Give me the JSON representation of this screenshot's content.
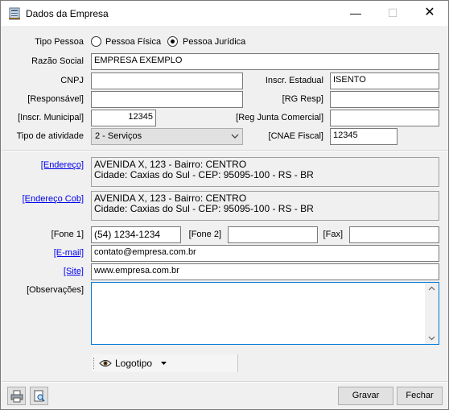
{
  "window": {
    "title": "Dados da Empresa",
    "minimize": "—",
    "maximize": "☐",
    "close": "✕"
  },
  "tipo_pessoa": {
    "label": "Tipo Pessoa",
    "option_fisica": "Pessoa Física",
    "option_juridica": "Pessoa Jurídica",
    "selected": "Pessoa Jurídica"
  },
  "razao_social": {
    "label": "Razão Social",
    "value": "EMPRESA EXEMPLO"
  },
  "cnpj": {
    "label": "CNPJ",
    "value": ""
  },
  "inscr_estadual": {
    "label": "Inscr. Estadual",
    "value": "ISENTO"
  },
  "responsavel": {
    "label": "[Responsável]",
    "value": ""
  },
  "rg_resp": {
    "label": "[RG Resp]",
    "value": ""
  },
  "inscr_municipal": {
    "label": "[Inscr. Municipal]",
    "value": "12345"
  },
  "reg_junta": {
    "label": "[Reg Junta Comercial]",
    "value": ""
  },
  "tipo_atividade": {
    "label": "Tipo de atividade",
    "value": "2 - Serviços"
  },
  "cnae_fiscal": {
    "label": "[CNAE Fiscal]",
    "value": "12345"
  },
  "endereco": {
    "label": "[Endereço]",
    "line1": "AVENIDA X, 123  -  Bairro: CENTRO",
    "line2": "Cidade: Caxias do Sul  -  CEP: 95095-100  -  RS  -  BR"
  },
  "endereco_cob": {
    "label": "[Endereço Cob]",
    "line1": "AVENIDA X, 123  -  Bairro: CENTRO",
    "line2": "Cidade: Caxias do Sul  -  CEP: 95095-100  -  RS  -  BR"
  },
  "fone1": {
    "label": "[Fone 1]",
    "value": "(54) 1234-1234"
  },
  "fone2": {
    "label": "[Fone 2]",
    "value": ""
  },
  "fax": {
    "label": "[Fax]",
    "value": ""
  },
  "email": {
    "label": "[E-mail]",
    "value": "contato@empresa.com.br"
  },
  "site": {
    "label": "[Site]",
    "value": "www.empresa.com.br"
  },
  "observacoes": {
    "label": "[Observações]",
    "value": ""
  },
  "logotipo": {
    "label": "Logotipo",
    "icon": "eye-icon"
  },
  "footer": {
    "gravar": "Gravar",
    "fechar": "Fechar",
    "print_icon": "printer-icon",
    "preview_icon": "print-preview-icon"
  }
}
